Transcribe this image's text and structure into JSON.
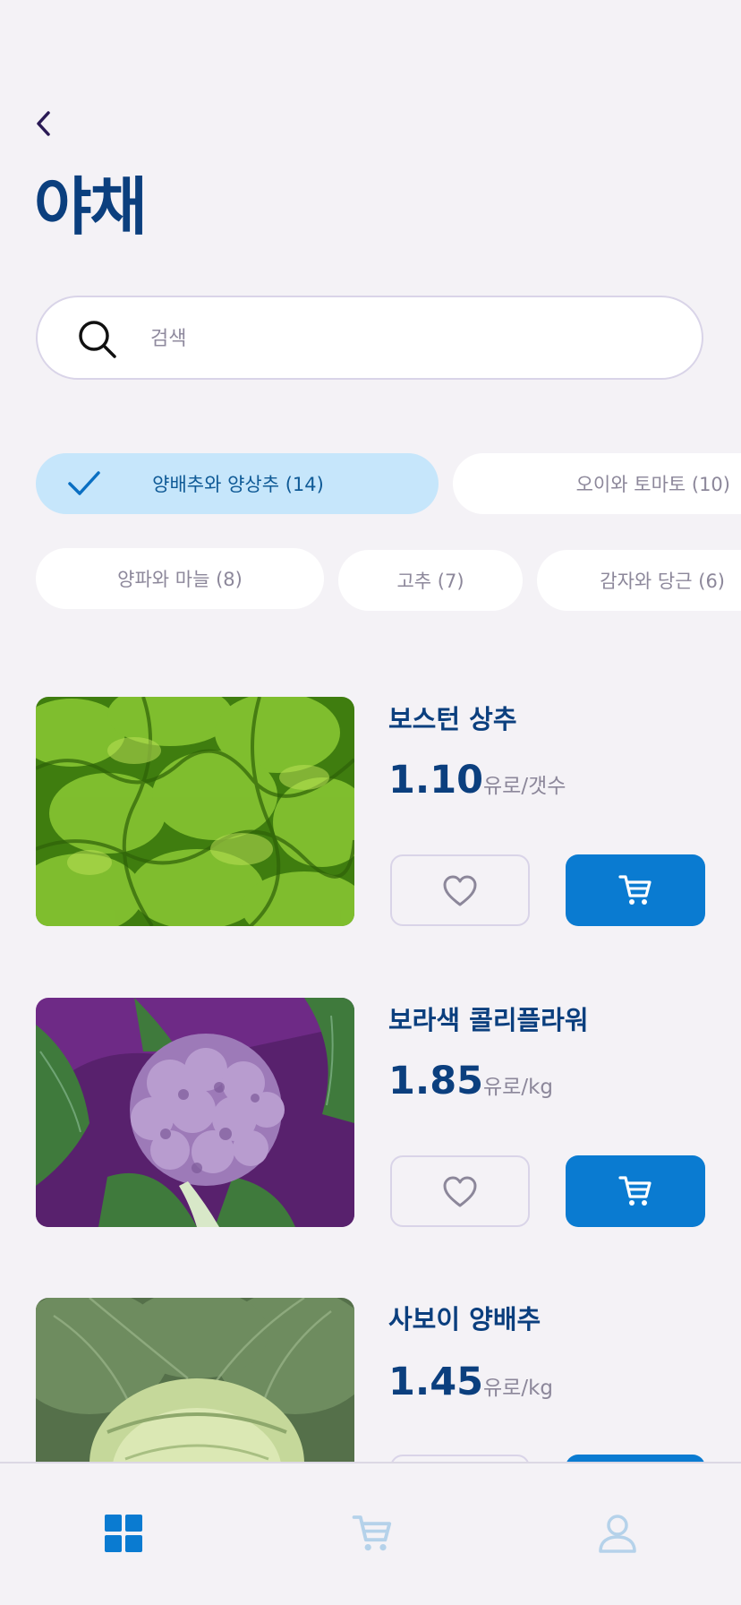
{
  "header": {
    "title": "야채"
  },
  "search": {
    "placeholder": "검색",
    "value": ""
  },
  "categories": [
    {
      "label": "양배추와 양상추 (14)",
      "selected": true
    },
    {
      "label": "오이와 토마토 (10)",
      "selected": false
    },
    {
      "label": "양파와 마늘 (8)",
      "selected": false
    },
    {
      "label": "고추 (7)",
      "selected": false
    },
    {
      "label": "감자와 당근 (6)",
      "selected": false
    }
  ],
  "products": [
    {
      "name": "보스턴 상추",
      "price": "1.10",
      "unit": "유로/갯수",
      "image": "lettuce"
    },
    {
      "name": "보라색 콜리플라워",
      "price": "1.85",
      "unit": "유로/kg",
      "image": "purple-cauliflower"
    },
    {
      "name": "사보이 양배추",
      "price": "1.45",
      "unit": "유로/kg",
      "image": "savoy-cabbage"
    }
  ],
  "icons": {
    "back": "chevron-left-icon",
    "search": "search-icon",
    "check": "check-icon",
    "favorite": "heart-icon",
    "cart": "cart-icon",
    "nav_home": "grid-icon",
    "nav_cart": "cart-icon",
    "nav_profile": "user-icon"
  },
  "colors": {
    "title": "#0b3f7e",
    "accent": "#0a7bd1",
    "chip_active_bg": "#c6e6fb",
    "chip_active_text": "#0f5a96",
    "background": "#f4f2f6",
    "nav_inactive": "#b5d2ea"
  }
}
